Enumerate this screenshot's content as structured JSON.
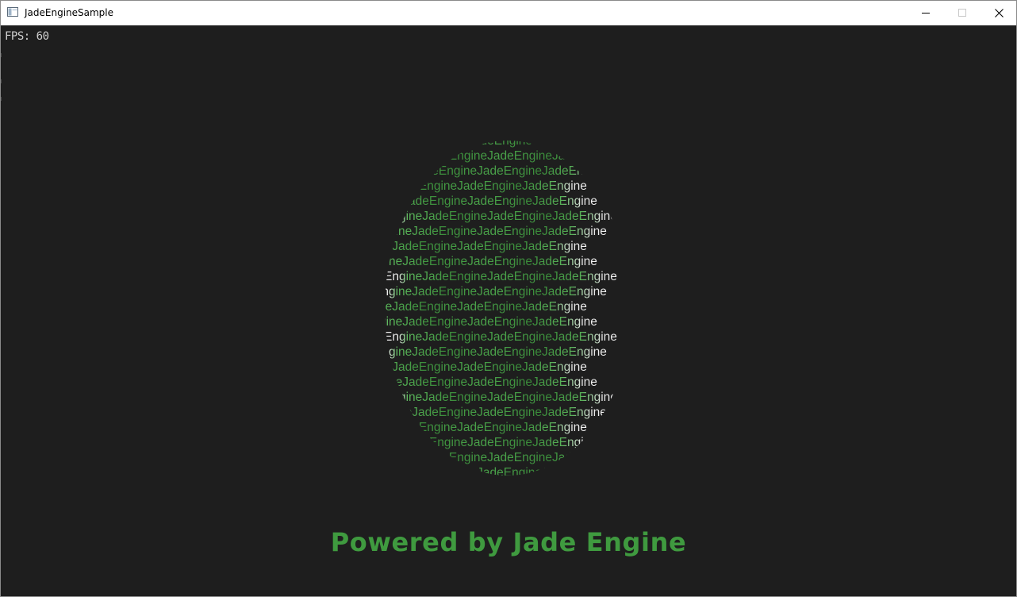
{
  "window": {
    "title": "JadeEngineSample",
    "controls": {
      "minimize_icon": "minimize-icon",
      "maximize_icon": "maximize-icon",
      "close_icon": "close-icon"
    }
  },
  "hud": {
    "fps_text": "FPS: 60"
  },
  "scene": {
    "orb_lines": [
      "EngineJadeEngineJadeEngineJadeEngine",
      "EngineJadeEngineJadeEngineJadeEngine",
      "EngineJadeEngineJadeEngineJadeEngine",
      "EngineJadeEngineJadeEngineJadeEngine",
      "EngineJadeEngineJadeEngineJadeEngine",
      "EngineJadeEngineJadeEngineJadeEngine",
      "EngineJadeEngineJadeEngineJadeEngine",
      "EngineJadeEngineJadeEngineJadeEngine",
      "EngineJadeEngineJadeEngineJadeEngine",
      "EngineJadeEngineJadeEngineJadeEngine",
      "EngineJadeEngineJadeEngineJadeEngine",
      "EngineJadeEngineJadeEngineJadeEngine",
      "EngineJadeEngineJadeEngineJadeEngine",
      "EngineJadeEngineJadeEngineJadeEngine",
      "EngineJadeEngineJadeEngineJadeEngine",
      "EngineJadeEngineJadeEngineJadeEngine",
      "EngineJadeEngineJadeEngineJadeEngine",
      "EngineJadeEngineJadeEngineJadeEngine",
      "EngineJadeEngineJadeEngineJadeEngine",
      "EngineJadeEngineJadeEngineJadeEngine",
      "EngineJadeEngineJadeEngineJadeEngine",
      "EngineJadeEngineJadeEngineJadeEngine",
      "EngineJadeEngineJadeEngineJadeEngine"
    ],
    "powered_text": "Powered by Jade Engine"
  },
  "colors": {
    "viewport_bg": "#1e1e1e",
    "jade_green": "#3f9a3f",
    "fps_text": "#d0d0d0"
  }
}
